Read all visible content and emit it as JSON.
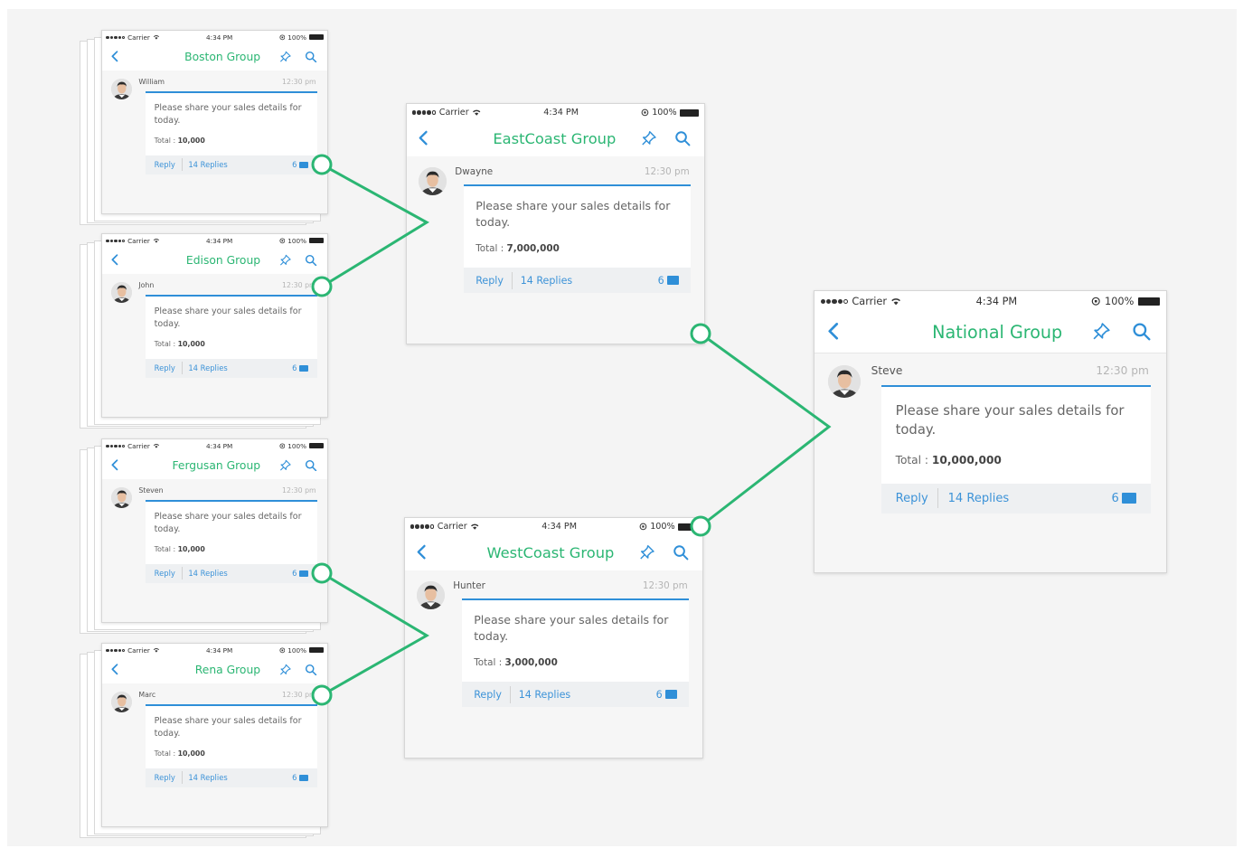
{
  "status": {
    "carrier": "Carrier",
    "time": "4:34 PM",
    "battery": "100%"
  },
  "post": {
    "message": "Please share your sales details for today.",
    "total_label": "Total :",
    "timestamp": "12:30 pm",
    "reply_label": "Reply",
    "replies_label": "14 Replies",
    "count": "6"
  },
  "small_phones": [
    {
      "title": "Boston Group",
      "author": "William",
      "total": "10,000"
    },
    {
      "title": "Edison Group",
      "author": "John",
      "total": "10,000"
    },
    {
      "title": "Fergusan Group",
      "author": "Steven",
      "total": "10,000"
    },
    {
      "title": "Rena Group",
      "author": "Marc",
      "total": "10,000"
    }
  ],
  "regional_phones": [
    {
      "title": "EastCoast Group",
      "author": "Dwayne",
      "total": "7,000,000"
    },
    {
      "title": "WestCoast Group",
      "author": "Hunter",
      "total": "3,000,000"
    }
  ],
  "national_phone": {
    "title": "National Group",
    "author": "Steve",
    "total": "10,000,000"
  },
  "colors": {
    "accent_green": "#2bb673",
    "link_blue": "#2f8fd8",
    "connector_green": "#2bb673"
  },
  "icons": [
    "back-chevron-icon",
    "pin-icon",
    "search-icon",
    "wifi-icon",
    "lock-rotation-icon",
    "battery-icon",
    "comment-bubble-icon"
  ]
}
